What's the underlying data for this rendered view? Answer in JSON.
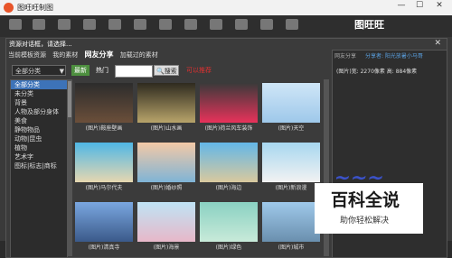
{
  "window": {
    "title": "图旺旺制图",
    "minimize": "—",
    "maximize": "☐",
    "close": "✕"
  },
  "toolbar": {
    "brand": "图旺旺"
  },
  "dialog": {
    "title": "资源对话框，请选择...",
    "close": "✕",
    "tabs": [
      "当前模板资源",
      "我的素材",
      "网友分享",
      "加载过的素材"
    ],
    "active_tab": 2
  },
  "filter": {
    "category_select": "全部分类",
    "latest": "最新",
    "hot": "热门",
    "search_label": "搜索",
    "tip": "可以推荐"
  },
  "categories": [
    "全部分类",
    "未分类",
    "背景",
    "人物及部分身体",
    "美食",
    "静物物品",
    "动物|昆虫",
    "植物",
    "艺术字",
    "图标|标志|商标"
  ],
  "selected_category": 0,
  "images": [
    {
      "caption": "(图片)鞍座壁画",
      "colors": [
        "#2c2c2c",
        "#6b4f3a"
      ]
    },
    {
      "caption": "(图片)山水画",
      "colors": [
        "#2e2a1f",
        "#b8a46a"
      ]
    },
    {
      "caption": "(图片)荷兰风车装饰",
      "colors": [
        "#3a3a3a",
        "#e8325a"
      ]
    },
    {
      "caption": "(图片)天空",
      "colors": [
        "#cfe6f7",
        "#9ec8ea"
      ]
    },
    {
      "caption": "(图片)马尔代夫",
      "colors": [
        "#4fb7e6",
        "#e6d7b0"
      ]
    },
    {
      "caption": "(图片)婚纱照",
      "colors": [
        "#f3c9a6",
        "#7fb4d6"
      ]
    },
    {
      "caption": "(图片)海边",
      "colors": [
        "#63b7e8",
        "#d9c99e"
      ]
    },
    {
      "caption": "(图片)新浪漫",
      "colors": [
        "#a7d7f0",
        "#f2f2f2"
      ]
    },
    {
      "caption": "(图片)清真寺",
      "colors": [
        "#7aa7e0",
        "#3b5a8a"
      ]
    },
    {
      "caption": "(图片)海景",
      "colors": [
        "#bfe3f5",
        "#e7b8c9"
      ]
    },
    {
      "caption": "(图片)绿色",
      "colors": [
        "#8ad1c2",
        "#c8ead9"
      ]
    },
    {
      "caption": "(图片)城市",
      "colors": [
        "#9fc9ea",
        "#6a8fae"
      ]
    }
  ],
  "preview": {
    "title": "网友分享",
    "link": "分享者: 阳光放暑小马哥",
    "info": "(图片)宽: 2270像素 高: 884像素"
  },
  "watermark": {
    "main": "百科全说",
    "sub": "助你轻松解决"
  }
}
